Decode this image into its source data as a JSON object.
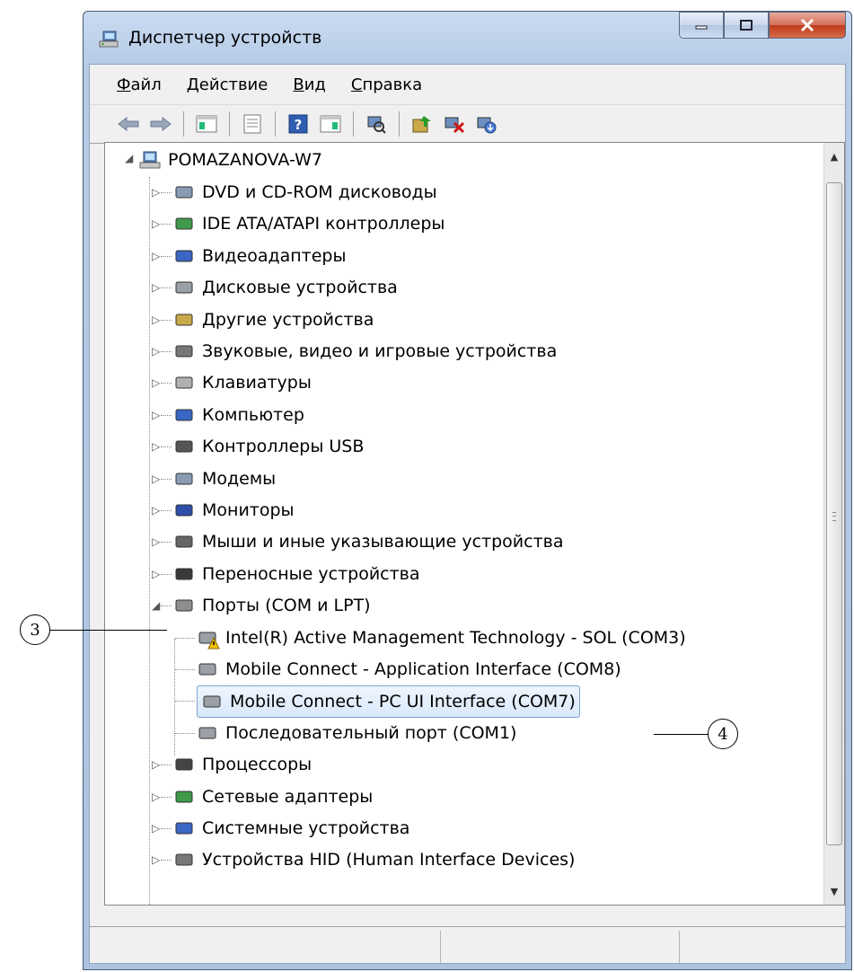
{
  "window": {
    "title": "Диспетчер устройств"
  },
  "menu": [
    {
      "key": "Ф",
      "rest": "айл"
    },
    {
      "key": "Д",
      "rest": "ействие"
    },
    {
      "key": "В",
      "rest": "ид"
    },
    {
      "key": "С",
      "rest": "правка"
    }
  ],
  "toolbar": {
    "icons": [
      "back-icon",
      "forward-icon",
      "properties-icon",
      "show-hide-console-tree-icon",
      "help-icon",
      "action-pane-icon",
      "scan-hardware-icon",
      "update-driver-icon",
      "uninstall-icon",
      "disable-icon"
    ]
  },
  "tree": {
    "root": "POMAZANOVA-W7",
    "categories": [
      "DVD и CD-ROM дисководы",
      "IDE ATA/ATAPI контроллеры",
      "Видеоадаптеры",
      "Дисковые устройства",
      "Другие устройства",
      "Звуковые, видео и игровые устройства",
      "Клавиатуры",
      "Компьютер",
      "Контроллеры USB",
      "Модемы",
      "Мониторы",
      "Мыши и иные указывающие устройства",
      "Переносные устройства",
      "Порты (COM и LPT)"
    ],
    "ports": [
      "Intel(R) Active Management Technology - SOL (COM3)",
      "Mobile Connect - Application Interface (COM8)",
      "Mobile Connect - PC UI Interface (COM7)",
      "Последовательный порт (COM1)"
    ],
    "after": [
      "Процессоры",
      "Сетевые адаптеры",
      "Системные устройства",
      "Устройства HID (Human Interface Devices)"
    ]
  },
  "callouts": {
    "a": "3",
    "b": "4"
  },
  "colors": {
    "selection": "#d8e8fa",
    "title_bar": "#b6cbe6",
    "close": "#c0391b"
  }
}
